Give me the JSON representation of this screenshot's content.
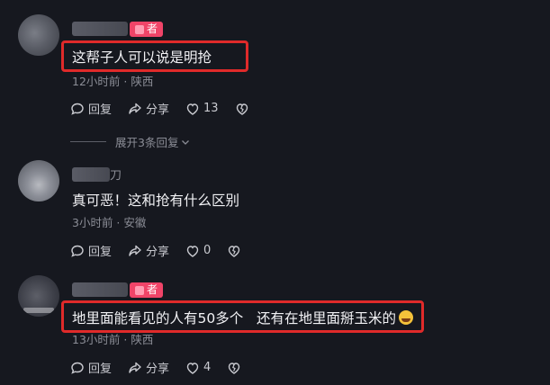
{
  "comments": [
    {
      "badge": "者",
      "text": "这帮子人可以说是明抢",
      "meta": "12小时前 · 陕西",
      "reply": "回复",
      "share": "分享",
      "likes": "13",
      "expand": "展开3条回复"
    },
    {
      "name_tail": "刀",
      "text": "真可恶！这和抢有什么区别",
      "meta": "3小时前 · 安徽",
      "reply": "回复",
      "share": "分享",
      "likes": "0"
    },
    {
      "badge": "者",
      "text": "地里面能看见的人有50多个   还有在地里面掰玉米的",
      "meta": "13小时前 · 陕西",
      "reply": "回复",
      "share": "分享",
      "likes": "4"
    }
  ],
  "icons": {
    "reply": "reply-icon",
    "share": "share-icon",
    "like": "heart-icon",
    "dislike": "broken-heart-icon",
    "emoji": "rofl-emoji-icon"
  },
  "colors": {
    "background": "#16181f",
    "highlight": "#e02a2a",
    "badge": "#f04468"
  }
}
